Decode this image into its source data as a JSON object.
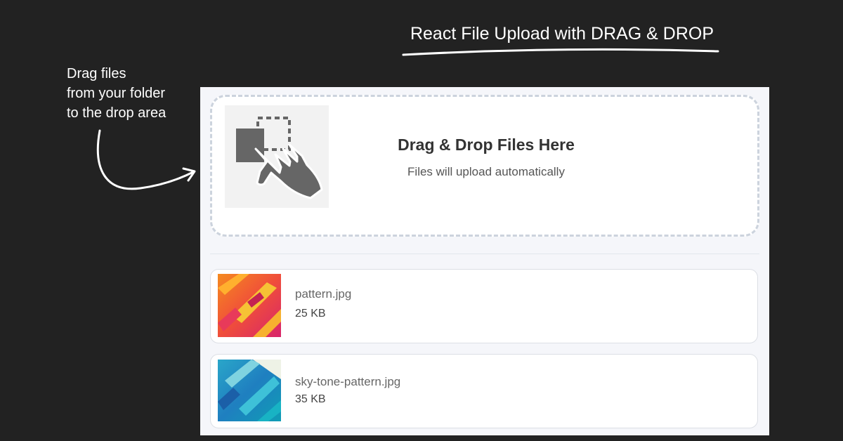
{
  "banner": {
    "title": "React File Upload with DRAG & DROP"
  },
  "hint": {
    "lines": [
      "Drag files",
      "from your folder",
      "to the drop area"
    ]
  },
  "dropzone": {
    "heading": "Drag & Drop Files Here",
    "subtext": "Files will upload automatically",
    "icon": "drag-hand-icon"
  },
  "files": [
    {
      "name": "pattern.jpg",
      "size": "25 KB",
      "thumbnail": "warm-paint-pattern"
    },
    {
      "name": "sky-tone-pattern.jpg",
      "size": "35 KB",
      "thumbnail": "blue-paint-pattern"
    }
  ],
  "colors": {
    "background": "#222222",
    "panel": "#f5f6fa",
    "dashed_border": "#ccd3dd",
    "icon_gray": "#666666"
  }
}
